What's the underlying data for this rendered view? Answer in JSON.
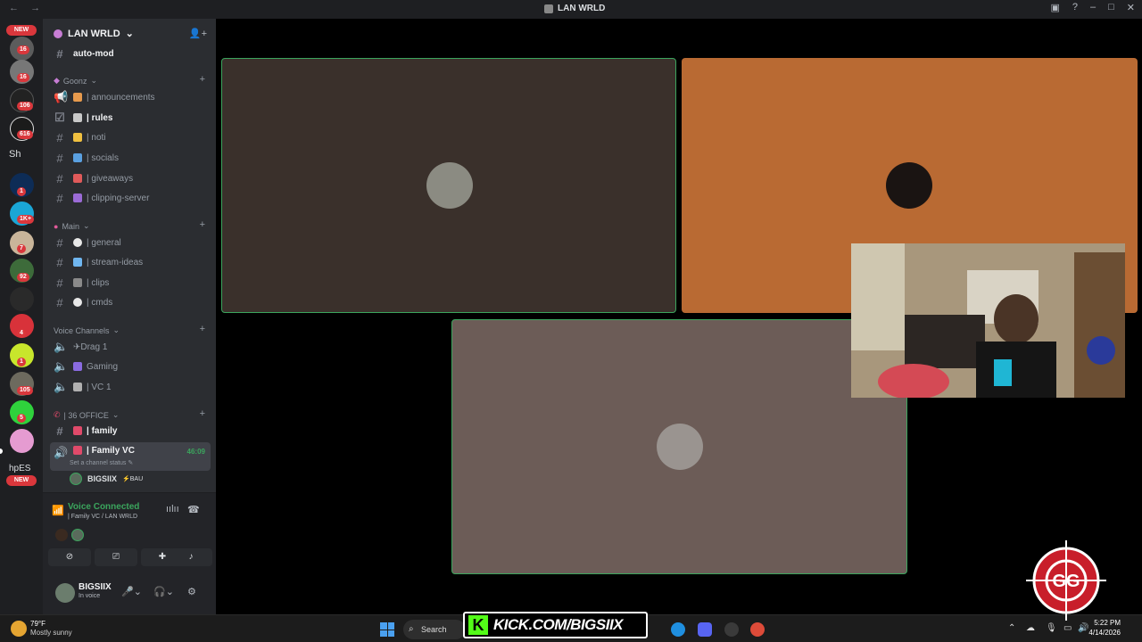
{
  "window": {
    "title": "LAN WRLD",
    "nav_back": "←",
    "nav_forward": "→"
  },
  "guild_bar": {
    "new_badge_top": "NEW",
    "new_badge_bottom": "NEW",
    "badges": [
      "16",
      "16",
      "106",
      "616",
      "1",
      "1K+",
      "7",
      "92",
      "4",
      "1",
      "105",
      "5"
    ],
    "text_server_sh": "Sh",
    "text_server_hpes": "hpES"
  },
  "server": {
    "name": "LAN WRLD",
    "channels_top": [
      {
        "name": "auto-mod",
        "bold": true
      }
    ],
    "categories": [
      {
        "name": "Goonz",
        "channels": [
          {
            "label": "| announcements",
            "icon": "megaphone-icon",
            "emoji_color": "#e79a4d"
          },
          {
            "label": "| rules",
            "icon": "rules-icon",
            "emoji_color": "#c9c9c9",
            "bold": true
          },
          {
            "label": "| noti",
            "icon": "hash-icon",
            "emoji_color": "#f0c040"
          },
          {
            "label": "| socials",
            "icon": "hash-icon",
            "emoji_color": "#5aa0e0"
          },
          {
            "label": "| giveaways",
            "icon": "hash-icon",
            "emoji_color": "#e05a5a"
          },
          {
            "label": "| clipping-server",
            "icon": "hash-icon",
            "emoji_color": "#9b6bd6"
          }
        ]
      },
      {
        "name": "Main",
        "channels": [
          {
            "label": "| general",
            "icon": "hash-icon",
            "emoji_color": "#e8e8e8"
          },
          {
            "label": "| stream-ideas",
            "icon": "hash-icon",
            "emoji_color": "#6fb6f0"
          },
          {
            "label": "| clips",
            "icon": "hash-icon",
            "emoji_color": "#8a8a8a"
          },
          {
            "label": "| cmds",
            "icon": "hash-icon",
            "emoji_color": "#e8e8e8"
          }
        ]
      },
      {
        "name": "Voice Channels",
        "channels": [
          {
            "label": "✈Drag 1",
            "icon": "speaker-icon"
          },
          {
            "label": "Gaming",
            "icon": "speaker-icon",
            "emoji_color": "#8a6be0"
          },
          {
            "label": "| VC 1",
            "icon": "speaker-icon",
            "emoji_color": "#b0b0b0"
          }
        ]
      },
      {
        "name": "| 36 OFFICE",
        "channels": [
          {
            "label": "| family",
            "icon": "hash-icon",
            "emoji_color": "#e04a6a",
            "bold": true
          },
          {
            "label": "| Family VC",
            "icon": "speaker-icon",
            "emoji_color": "#e04a6a",
            "selected": true,
            "timer": "46:09"
          }
        ]
      }
    ],
    "channel_status_hint": "Set a channel status",
    "voice_user": {
      "name": "BIGSIIX",
      "tag": "BAU"
    }
  },
  "voice_panel": {
    "status": "Voice Connected",
    "location": "| Family VC / LAN WRLD"
  },
  "user_panel": {
    "name": "BIGSIIX",
    "status": "In voice"
  },
  "taskbar": {
    "weather_temp": "79°F",
    "weather_desc": "Mostly sunny",
    "search_label": "Search",
    "kick_url": "KICK.COM/BIGSIIX",
    "time": "5:22 PM",
    "date": "4/14/2026"
  },
  "colors": {
    "speaking_border": "#3ba55d",
    "tile1_bg": "#3a302b",
    "tile2_bg": "#b96a33",
    "tile3_bg": "#6c5c57",
    "kick_green": "#53fc18"
  }
}
